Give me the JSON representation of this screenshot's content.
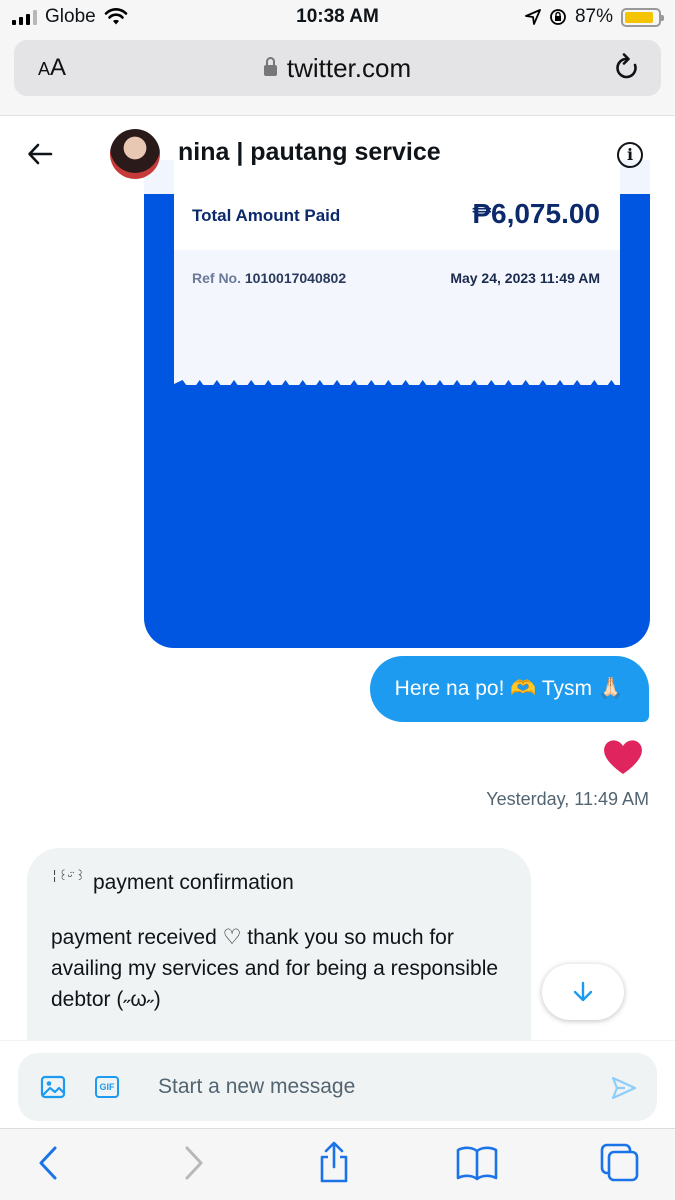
{
  "status_bar": {
    "carrier": "Globe",
    "time": "10:38 AM",
    "battery_percent": "87%",
    "battery_level": 0.87,
    "battery_color": "#f5c400"
  },
  "browser": {
    "text_size_label": "AA",
    "url": "twitter.com",
    "icons": {
      "lock": "lock-icon",
      "reload": "reload-icon"
    }
  },
  "conversation": {
    "title": "nina | pautang service",
    "icons": {
      "back": "arrow-left-icon",
      "info": "info-icon"
    }
  },
  "receipt": {
    "total_label": "Total Amount Paid",
    "total_amount": "₱6,075.00",
    "ref_label": "Ref No.",
    "ref_number": "1010017040802",
    "date": "May 24, 2023 11:49 AM",
    "brand_color": "#0056e0"
  },
  "messages": {
    "sent_text": "Here na po! 🫶 Tysm 🙏🏻",
    "reaction": "❤️",
    "sent_time": "Yesterday, 11:49 AM",
    "received_title": "payment confirmation",
    "received_deco": "╎꒰ᵕ̈ ꒱",
    "received_body": "payment received ♡ thank you so much for availing my services and for being a responsible debtor (˶ω˶)"
  },
  "composer": {
    "placeholder": "Start a new message",
    "icons": {
      "media": "image-icon",
      "gif": "gif-icon",
      "send": "send-icon"
    },
    "gif_label": "GIF"
  },
  "toolbar": {
    "icons": [
      "back-chevron-icon",
      "forward-chevron-icon",
      "share-icon",
      "bookmarks-icon",
      "tabs-icon"
    ]
  },
  "colors": {
    "accent": "#1d9bf0",
    "heart": "#e0245e"
  }
}
